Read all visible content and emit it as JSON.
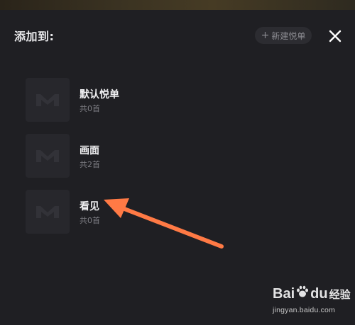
{
  "header": {
    "title": "添加到:",
    "new_button_label": "新建悦单",
    "new_button_icon": "plus-icon",
    "close_icon": "close-icon"
  },
  "playlists": [
    {
      "name": "默认悦单",
      "count": "共0首",
      "cover_icon": "m-logo-icon"
    },
    {
      "name": "画面",
      "count": "共2首",
      "cover_icon": "m-logo-icon"
    },
    {
      "name": "看见",
      "count": "共0首",
      "cover_icon": "m-logo-icon"
    }
  ],
  "annotation": {
    "arrow_color": "#ff7a45",
    "points_to": "看见"
  },
  "watermark": {
    "brand_left": "Bai",
    "brand_right": "du",
    "brand_cn": "经验",
    "url": "jingyan.baidu.com"
  },
  "colors": {
    "background": "#1f1f23",
    "cover": "#27272c",
    "button": "#2c2c31",
    "text_primary": "#f0f0f2",
    "text_secondary": "#7e7e84"
  }
}
